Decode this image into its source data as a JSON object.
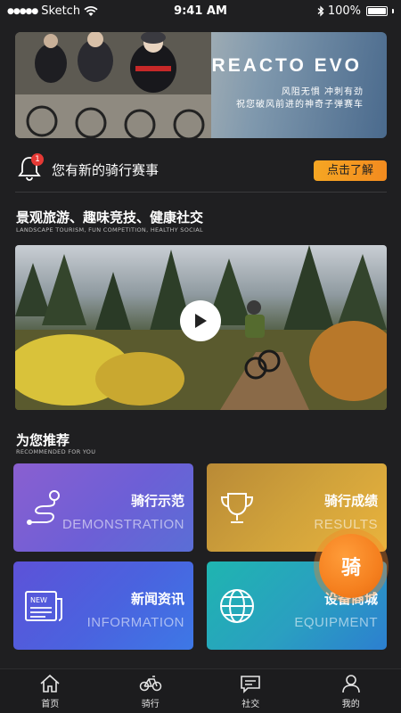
{
  "status_bar": {
    "carrier": "Sketch",
    "time": "9:41 AM",
    "battery": "100%"
  },
  "banner": {
    "title": "REACTO EVO",
    "subtitle_line1": "风阻无惧 冲刺有劲",
    "subtitle_line2": "祝您破风前进的神奇子弹赛车"
  },
  "notice": {
    "badge_count": "1",
    "text": "您有新的骑行赛事",
    "button_label": "点击了解"
  },
  "section_video": {
    "title": "景观旅游、趣味竞技、健康社交",
    "subtitle": "LANDSCAPE TOURISM, FUN COMPETITION, HEALTHY SOCIAL"
  },
  "section_recommend": {
    "title": "为您推荐",
    "subtitle": "RECOMMENDED FOR YOU"
  },
  "cards": {
    "demo": {
      "cn": "骑行示范",
      "en": "DEMONSTRATION",
      "icon": "route-icon"
    },
    "results": {
      "cn": "骑行成绩",
      "en": "RESULTS",
      "icon": "trophy-icon"
    },
    "news": {
      "cn": "新闻资讯",
      "en": "INFORMATION",
      "icon": "newspaper-icon",
      "icon_label": "NEW"
    },
    "equip": {
      "cn": "设备商城",
      "en": "EQUIPMENT",
      "icon": "globe-icon"
    }
  },
  "ride_button": {
    "label": "骑"
  },
  "tabbar": {
    "home": "首页",
    "ride": "骑行",
    "social": "社交",
    "mine": "我的"
  },
  "colors": {
    "accent_orange": "#f5801f",
    "background": "#1f1f21",
    "badge_red": "#e53935"
  }
}
